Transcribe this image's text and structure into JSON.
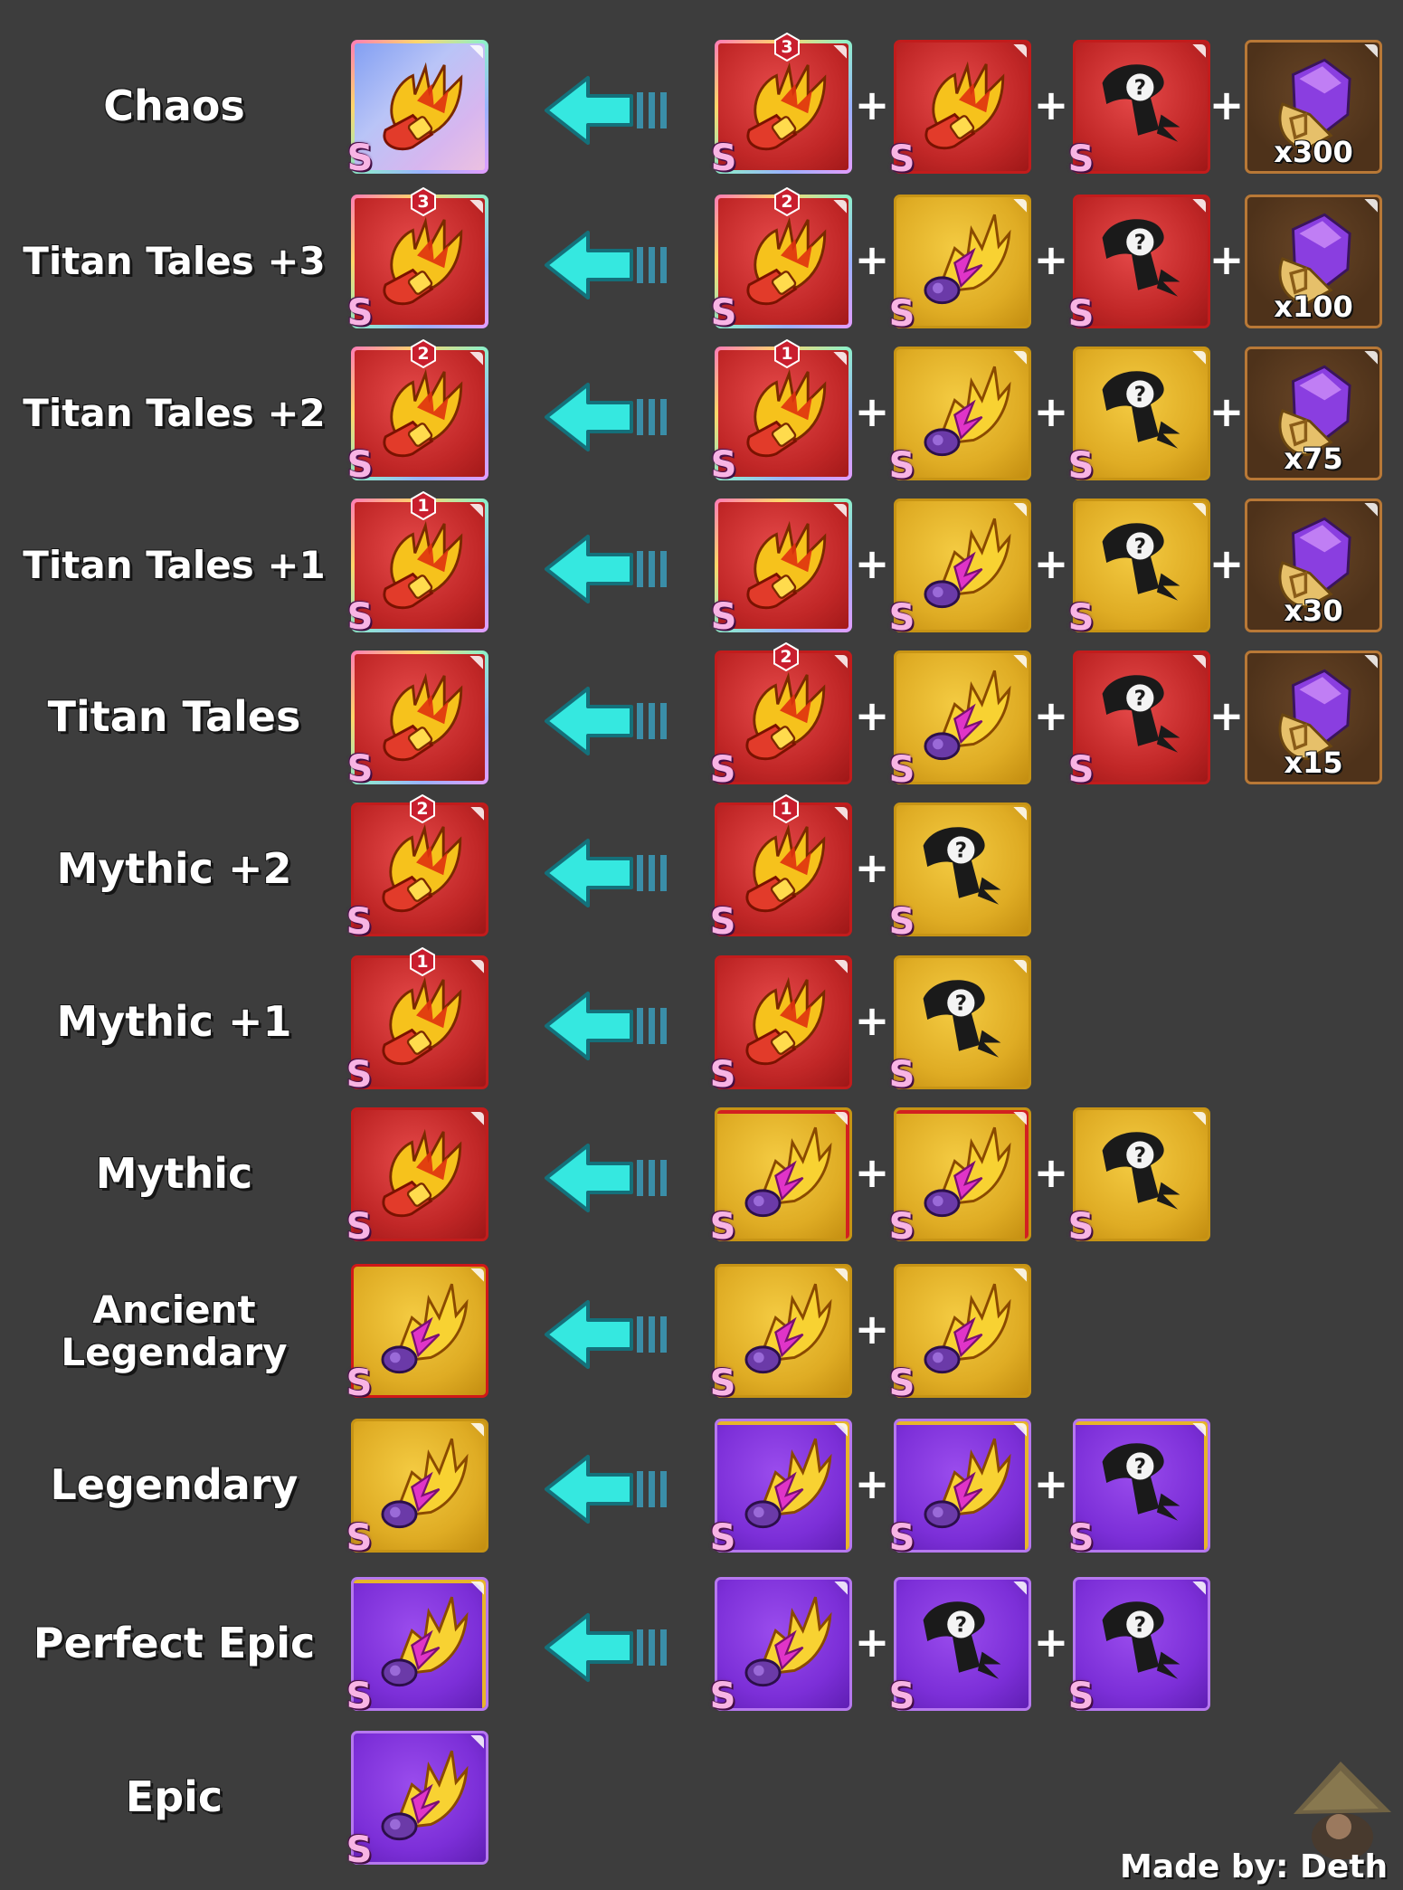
{
  "credit": "Made by: Deth",
  "colors": {
    "background": "#3d3d3d",
    "arrow": "#35e8e0",
    "red_tile": "#c12727",
    "gold_tile": "#dfac24",
    "purple_tile": "#7c2fd8",
    "chaos_tile": "#9fb5f4",
    "fodder_tile": "#4e321a"
  },
  "rows": [
    {
      "tier": "Chaos",
      "result": {
        "color": "chaos",
        "icon": "flame-gauntlet-icon",
        "rainbow": true
      },
      "recipe": [
        {
          "color": "red",
          "icon": "flame-gauntlet-icon",
          "rank": "3",
          "rainbow": true
        },
        {
          "color": "red",
          "icon": "flame-gauntlet-icon"
        },
        {
          "color": "red",
          "icon": "mystery-weapon-icon",
          "fodder": true
        },
        {
          "color": "bronze",
          "icon": "purple-crystal-icon",
          "qty": "x300"
        }
      ]
    },
    {
      "tier": "Titan Tales +3",
      "result": {
        "color": "red",
        "icon": "flame-gauntlet-icon",
        "rank": "3",
        "rainbow": true
      },
      "recipe": [
        {
          "color": "red",
          "icon": "flame-gauntlet-icon",
          "rank": "2",
          "rainbow": true
        },
        {
          "color": "gold",
          "icon": "flame-claw-icon"
        },
        {
          "color": "red",
          "icon": "mystery-weapon-icon",
          "fodder": true
        },
        {
          "color": "bronze",
          "icon": "purple-crystal-icon",
          "qty": "x100"
        }
      ]
    },
    {
      "tier": "Titan Tales +2",
      "result": {
        "color": "red",
        "icon": "flame-gauntlet-icon",
        "rank": "2",
        "rainbow": true
      },
      "recipe": [
        {
          "color": "red",
          "icon": "flame-gauntlet-icon",
          "rank": "1",
          "rainbow": true
        },
        {
          "color": "gold",
          "icon": "flame-claw-icon"
        },
        {
          "color": "gold",
          "icon": "mystery-weapon-icon",
          "fodder": true
        },
        {
          "color": "bronze",
          "icon": "purple-crystal-icon",
          "qty": "x75"
        }
      ]
    },
    {
      "tier": "Titan Tales +1",
      "result": {
        "color": "red",
        "icon": "flame-gauntlet-icon",
        "rank": "1",
        "rainbow": true
      },
      "recipe": [
        {
          "color": "red",
          "icon": "flame-gauntlet-icon",
          "rainbow": true
        },
        {
          "color": "gold",
          "icon": "flame-claw-icon"
        },
        {
          "color": "gold",
          "icon": "mystery-weapon-icon",
          "fodder": true
        },
        {
          "color": "bronze",
          "icon": "purple-crystal-icon",
          "qty": "x30"
        }
      ]
    },
    {
      "tier": "Titan Tales",
      "result": {
        "color": "red",
        "icon": "flame-gauntlet-icon",
        "rainbow": true
      },
      "recipe": [
        {
          "color": "red",
          "icon": "flame-gauntlet-icon",
          "rank": "2"
        },
        {
          "color": "gold",
          "icon": "flame-claw-icon"
        },
        {
          "color": "red",
          "icon": "mystery-weapon-icon",
          "fodder": true
        },
        {
          "color": "bronze",
          "icon": "purple-crystal-icon",
          "qty": "x15"
        }
      ]
    },
    {
      "tier": "Mythic +2",
      "result": {
        "color": "red",
        "icon": "flame-gauntlet-icon",
        "rank": "2"
      },
      "recipe": [
        {
          "color": "red",
          "icon": "flame-gauntlet-icon",
          "rank": "1"
        },
        {
          "color": "gold",
          "icon": "mystery-weapon-icon",
          "fodder": true
        }
      ]
    },
    {
      "tier": "Mythic +1",
      "result": {
        "color": "red",
        "icon": "flame-gauntlet-icon",
        "rank": "1"
      },
      "recipe": [
        {
          "color": "red",
          "icon": "flame-gauntlet-icon"
        },
        {
          "color": "gold",
          "icon": "mystery-weapon-icon",
          "fodder": true
        }
      ]
    },
    {
      "tier": "Mythic",
      "result": {
        "color": "red",
        "icon": "flame-gauntlet-icon"
      },
      "recipe": [
        {
          "color": "gold",
          "icon": "flame-claw-icon",
          "red_corner": true
        },
        {
          "color": "gold",
          "icon": "flame-claw-icon",
          "red_corner": true
        },
        {
          "color": "gold",
          "icon": "mystery-weapon-icon",
          "fodder": true
        }
      ]
    },
    {
      "tier": "Ancient\nLegendary",
      "result": {
        "color": "gold",
        "icon": "flame-claw-icon",
        "red_border": true
      },
      "recipe": [
        {
          "color": "gold",
          "icon": "flame-claw-icon"
        },
        {
          "color": "gold",
          "icon": "flame-claw-icon"
        }
      ]
    },
    {
      "tier": "Legendary",
      "result": {
        "color": "gold",
        "icon": "flame-claw-icon"
      },
      "recipe": [
        {
          "color": "purple",
          "icon": "flame-claw-icon",
          "gold_corner": true
        },
        {
          "color": "purple",
          "icon": "flame-claw-icon",
          "gold_corner": true
        },
        {
          "color": "purple",
          "icon": "mystery-weapon-icon",
          "fodder": true,
          "gold_corner": true
        }
      ]
    },
    {
      "tier": "Perfect Epic",
      "result": {
        "color": "purple",
        "icon": "flame-claw-icon",
        "gold_corner": true
      },
      "recipe": [
        {
          "color": "purple",
          "icon": "flame-claw-icon"
        },
        {
          "color": "purple",
          "icon": "mystery-weapon-icon",
          "fodder": true
        },
        {
          "color": "purple",
          "icon": "mystery-weapon-icon",
          "fodder": true
        }
      ]
    },
    {
      "tier": "Epic",
      "result": {
        "color": "purple",
        "icon": "flame-claw-icon"
      },
      "recipe": []
    }
  ]
}
